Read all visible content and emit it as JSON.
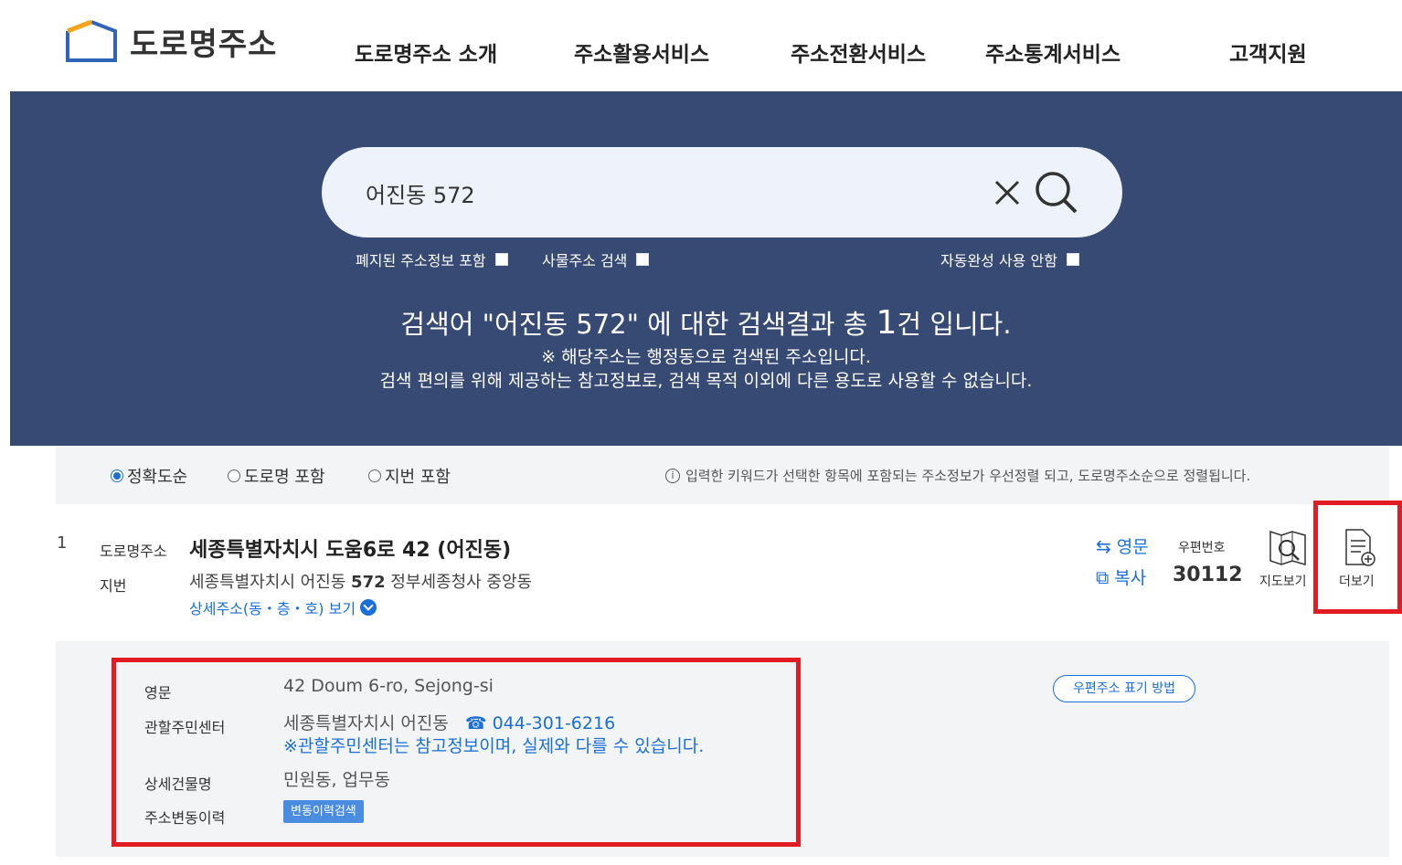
{
  "header": {
    "logo_text": "도로명주소",
    "nav": [
      "도로명주소 소개",
      "주소활용서비스",
      "주소전환서비스",
      "주소통계서비스",
      "고객지원"
    ]
  },
  "search": {
    "value": "어진동 572",
    "options": {
      "abolished": "폐지된 주소정보 포함",
      "object_addr": "사물주소 검색",
      "autocomplete_off": "자동완성 사용 안함"
    }
  },
  "result_summary": {
    "prefix": "검색어 ",
    "keyword": "\"어진동 572\"",
    "middle": " 에 대한 검색결과 총 ",
    "count": "1",
    "suffix": "건 입니다.",
    "note1": "※ 해당주소는 행정동으로 검색된 주소입니다.",
    "note2": "검색 편의를 위해 제공하는 참고정보로, 검색 목적 이외에 다른 용도로 사용할 수 없습니다."
  },
  "sort": {
    "exact": "정확도순",
    "road": "도로명 포함",
    "jibun": "지번 포함",
    "note": "입력한 키워드가 선택한 항목에 포함되는 주소정보가 우선정렬 되고, 도로명주소순으로 정렬됩니다."
  },
  "item": {
    "num": "1",
    "road_label": "도로명주소",
    "road_addr": "세종특별자치시 도움6로 42 (어진동)",
    "jibun_label": "지번",
    "jibun_prefix": "세종특별자치시 어진동 ",
    "jibun_num": "572",
    "jibun_suffix": " 정부세종청사 중앙동",
    "detail_link": "상세주소(동・층・호) 보기",
    "eng_btn": "영문",
    "copy_btn": "복사",
    "zip_label": "우편번호",
    "zip": "30112",
    "map_label": "지도보기",
    "more_label": "더보기"
  },
  "detail": {
    "eng_label": "영문",
    "eng_value": "42 Doum 6-ro, Sejong-si",
    "center_label": "관할주민센터",
    "center_value": "세종특별자치시 어진동",
    "center_phone": "044-301-6216",
    "center_note": "※관할주민센터는 참고정보이며, 실제와 다를 수 있습니다.",
    "bldg_label": "상세건물명",
    "bldg_value": "민원동, 업무동",
    "history_label": "주소변동이력",
    "history_btn": "변동이력검색",
    "post_btn": "우편주소 표기 방법"
  },
  "colors": {
    "hero_bg": "#364a74",
    "accent": "#1a6fd8",
    "highlight": "#e31c23"
  }
}
